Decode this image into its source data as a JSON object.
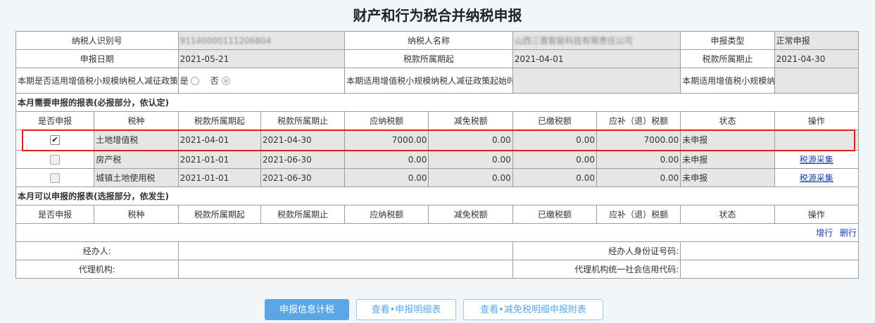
{
  "title": "财产和行为税合并纳税申报",
  "info": {
    "taxpayer_id_label": "纳税人识别号",
    "taxpayer_id_value": "91140000111206804",
    "taxpayer_name_label": "纳税人名称",
    "taxpayer_name_value": "山西三晋智能科技有限责任公司",
    "declare_type_label": "申报类型",
    "declare_type_value": "正常申报",
    "declare_date_label": "申报日期",
    "declare_date_value": "2021-05-21",
    "period_start_label": "税款所属期起",
    "period_start_value": "2021-04-01",
    "period_end_label": "税款所属期止",
    "period_end_value": "2021-04-30",
    "small_scale_label": "本期是否适用增值税小规模纳税人减征政策",
    "yes_label": "是",
    "no_label": "否",
    "policy_start_label": "本期适用增值税小规模纳税人减征政策起始时间",
    "policy_end_label": "本期适用增值税小规模纳税人减征政策终止时间"
  },
  "required_section": {
    "heading": "本月需要申报的报表(必报部分，依认定)",
    "columns": [
      "是否申报",
      "税种",
      "税款所属期起",
      "税款所属期止",
      "应纳税额",
      "减免税额",
      "已缴税额",
      "应补（退）税额",
      "状态",
      "操作"
    ],
    "rows": [
      {
        "checked": true,
        "tax": "土地增值税",
        "start": "2021-04-01",
        "end": "2021-04-30",
        "payable": "7000.00",
        "relief": "0.00",
        "paid": "0.00",
        "due": "7000.00",
        "status": "未申报",
        "action": ""
      },
      {
        "checked": false,
        "tax": "房产税",
        "start": "2021-01-01",
        "end": "2021-06-30",
        "payable": "0.00",
        "relief": "0.00",
        "paid": "0.00",
        "due": "0.00",
        "status": "未申报",
        "action": "税源采集"
      },
      {
        "checked": false,
        "tax": "城镇土地使用税",
        "start": "2021-01-01",
        "end": "2021-06-30",
        "payable": "0.00",
        "relief": "0.00",
        "paid": "0.00",
        "due": "0.00",
        "status": "未申报",
        "action": "税源采集"
      }
    ]
  },
  "optional_section": {
    "heading": "本月可以申报的报表(选报部分，依发生)",
    "columns": [
      "是否申报",
      "税种",
      "税款所属期起",
      "税款所属期止",
      "应纳税额",
      "减免税额",
      "已缴税额",
      "应补（退）税额",
      "状态",
      "操作"
    ],
    "add_row": "增行",
    "delete_row": "删行"
  },
  "agent": {
    "handler_label": "经办人:",
    "handler_id_label": "经办人身份证号码:",
    "agency_label": "代理机构:",
    "agency_code_label": "代理机构统一社会信用代码:"
  },
  "buttons": {
    "calc": "申报信息计税",
    "view_detail": "查看•申报明细表",
    "view_relief": "查看•减免税明细申报附表"
  }
}
